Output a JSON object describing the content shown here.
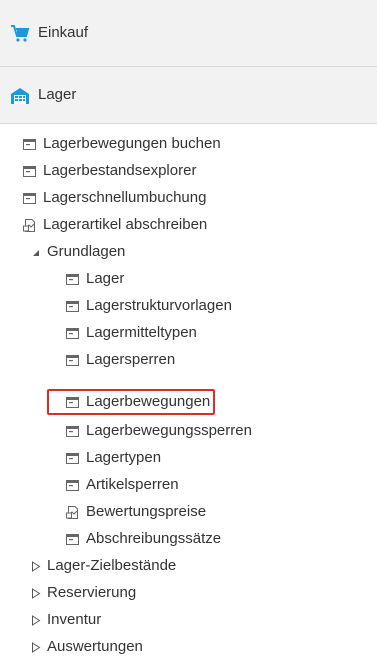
{
  "sections": {
    "einkauf": {
      "label": "Einkauf",
      "icon": "shopping-cart-icon",
      "color": "#1a9ad6"
    },
    "lager": {
      "label": "Lager",
      "icon": "warehouse-icon",
      "color": "#1a9ad6"
    }
  },
  "tree": {
    "items": [
      {
        "label": "Lagerbewegungen buchen",
        "icon": "window-icon"
      },
      {
        "label": "Lagerbestandsexplorer",
        "icon": "window-icon"
      },
      {
        "label": "Lagerschnellumbuchung",
        "icon": "window-icon"
      },
      {
        "label": "Lagerartikel abschreiben",
        "icon": "report-icon"
      },
      {
        "label": "Grundlagen",
        "icon": "expanded-arrow-icon"
      }
    ],
    "grundlagen": [
      {
        "label": "Lager",
        "icon": "window-icon"
      },
      {
        "label": "Lagerstrukturvorlagen",
        "icon": "window-icon"
      },
      {
        "label": "Lagermitteltypen",
        "icon": "window-icon"
      },
      {
        "label": "Lagersperren",
        "icon": "window-icon"
      },
      {
        "label": "Lagerbewegungen",
        "icon": "window-icon"
      },
      {
        "label": "Lagerbewegungssperren",
        "icon": "window-icon"
      },
      {
        "label": "Lagertypen",
        "icon": "window-icon"
      },
      {
        "label": "Artikelsperren",
        "icon": "window-icon"
      },
      {
        "label": "Bewertungspreise",
        "icon": "report-icon"
      },
      {
        "label": "Abschreibungssätze",
        "icon": "window-icon"
      }
    ],
    "collapsed": [
      {
        "label": "Lager-Zielbestände",
        "icon": "collapsed-arrow-icon"
      },
      {
        "label": "Reservierung",
        "icon": "collapsed-arrow-icon"
      },
      {
        "label": "Inventur",
        "icon": "collapsed-arrow-icon"
      },
      {
        "label": "Auswertungen",
        "icon": "collapsed-arrow-icon"
      }
    ]
  },
  "highlight_color": "#e02b2b"
}
